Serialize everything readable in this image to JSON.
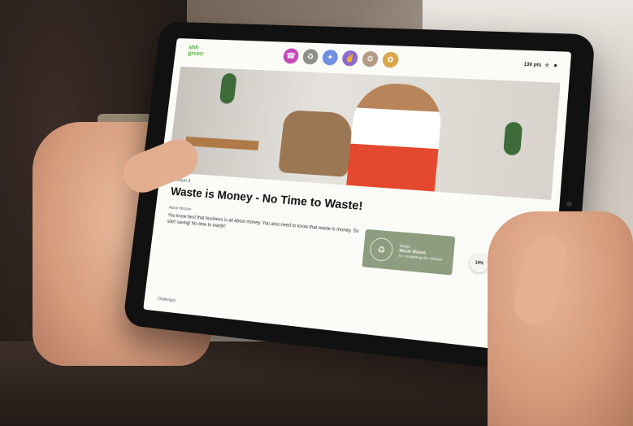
{
  "logo": {
    "line1": "ahh",
    "line2": "green"
  },
  "categories": [
    {
      "icon": "phone-icon",
      "color": "#c54ab9"
    },
    {
      "icon": "trash-icon",
      "color": "#8d8f88"
    },
    {
      "icon": "bird-icon",
      "color": "#6f8fe4"
    },
    {
      "icon": "hand-icon",
      "color": "#8a6ad0"
    },
    {
      "icon": "bike-icon",
      "color": "#b59b87"
    },
    {
      "icon": "leaf-icon",
      "color": "#d7a74a"
    }
  ],
  "header": {
    "points": "130 pts"
  },
  "lesson": {
    "label": "Mission 3",
    "title": "Waste is Money - No Time to Waste!",
    "about_label": "About mission",
    "description": "You know best that business is all about money. You also need to know that waste is money. So start saving! No time to waste!",
    "challenges_label": "Challenges"
  },
  "badge": {
    "title": "Badge",
    "name": "Waste Wizard",
    "subtitle": "for completing this mission"
  },
  "progress": {
    "percent_label": "14%"
  },
  "colors": {
    "accent": "#58b04a",
    "badge_bg": "#8e9d80"
  }
}
